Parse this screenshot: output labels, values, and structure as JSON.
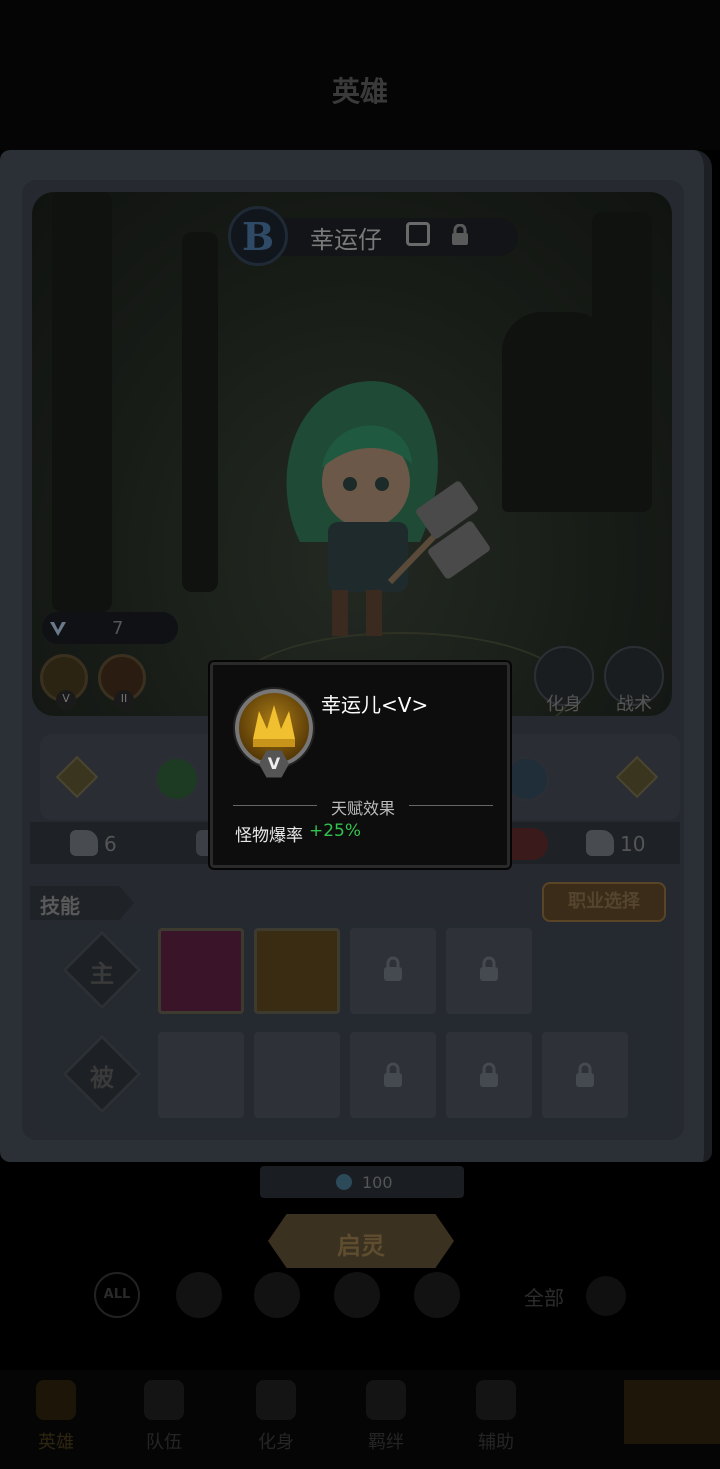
{
  "header": {
    "title": "英雄"
  },
  "hero": {
    "rank": "B",
    "name": "幸运仔",
    "level": "7",
    "talents": [
      {
        "mark": "V",
        "color": "#c8951a"
      },
      {
        "mark": "II",
        "color": "#b06a24"
      }
    ]
  },
  "actions": {
    "avatar_label": "化身",
    "tactics_label": "战术"
  },
  "stats": [
    {
      "icon": "fist-icon",
      "value": "6"
    },
    {
      "icon": "shield-icon",
      "value": ""
    },
    {
      "icon": "star-icon",
      "value": ""
    },
    {
      "icon": "heart-icon",
      "value": ""
    },
    {
      "icon": "arm-icon",
      "value": "10"
    }
  ],
  "skills": {
    "section_label": "技能",
    "job_select_label": "职业选择",
    "active_row_label": "主",
    "passive_row_label": "被"
  },
  "awaken": {
    "cost": "100",
    "button_label": "启灵"
  },
  "filters": {
    "all_label": "ALL",
    "sort_label": "全部"
  },
  "nav": {
    "items": [
      {
        "label": "英雄"
      },
      {
        "label": "队伍"
      },
      {
        "label": "化身"
      },
      {
        "label": "羁绊"
      },
      {
        "label": "辅助"
      }
    ]
  },
  "popup": {
    "title": "幸运儿<V>",
    "rank_mark": "V",
    "section_title": "天赋效果",
    "effect_label": "怪物爆率",
    "effect_value": "+25%"
  },
  "colors": {
    "effect_positive": "#33c24d",
    "popup_bg": "#0d0d0d"
  }
}
